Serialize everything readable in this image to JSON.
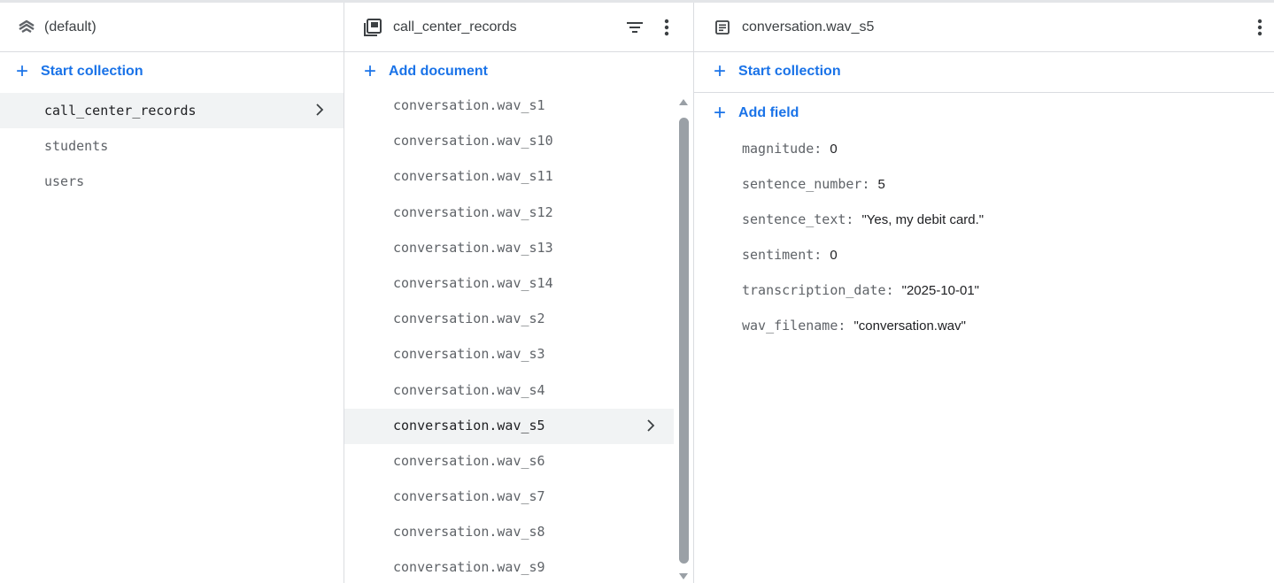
{
  "root": {
    "title": "(default)",
    "start_collection": "Start collection"
  },
  "collections": [
    {
      "name": "call_center_records",
      "selected": true
    },
    {
      "name": "students",
      "selected": false
    },
    {
      "name": "users",
      "selected": false
    }
  ],
  "collection_panel": {
    "title": "call_center_records",
    "add_document": "Add document"
  },
  "documents": [
    {
      "id": "conversation.wav_s1",
      "selected": false
    },
    {
      "id": "conversation.wav_s10",
      "selected": false
    },
    {
      "id": "conversation.wav_s11",
      "selected": false
    },
    {
      "id": "conversation.wav_s12",
      "selected": false
    },
    {
      "id": "conversation.wav_s13",
      "selected": false
    },
    {
      "id": "conversation.wav_s14",
      "selected": false
    },
    {
      "id": "conversation.wav_s2",
      "selected": false
    },
    {
      "id": "conversation.wav_s3",
      "selected": false
    },
    {
      "id": "conversation.wav_s4",
      "selected": false
    },
    {
      "id": "conversation.wav_s5",
      "selected": true
    },
    {
      "id": "conversation.wav_s6",
      "selected": false
    },
    {
      "id": "conversation.wav_s7",
      "selected": false
    },
    {
      "id": "conversation.wav_s8",
      "selected": false
    },
    {
      "id": "conversation.wav_s9",
      "selected": false
    }
  ],
  "document_panel": {
    "title": "conversation.wav_s5",
    "start_collection": "Start collection",
    "add_field": "Add field",
    "fields": [
      {
        "key": "magnitude",
        "value": "0"
      },
      {
        "key": "sentence_number",
        "value": "5"
      },
      {
        "key": "sentence_text",
        "value": "\"Yes, my debit card.\""
      },
      {
        "key": "sentiment",
        "value": "0"
      },
      {
        "key": "transcription_date",
        "value": "\"2025-10-01\""
      },
      {
        "key": "wav_filename",
        "value": "\"conversation.wav\""
      }
    ]
  },
  "icons": {
    "root": "database-stack-icon",
    "collection": "collection-icon",
    "filter": "filter-icon",
    "more": "more-vert-icon",
    "document": "document-icon",
    "add": "plus-icon",
    "chevron": "chevron-right-icon"
  },
  "colors": {
    "accent": "#1a73e8",
    "selected_bg": "#f1f3f4",
    "border": "#dadce0"
  }
}
